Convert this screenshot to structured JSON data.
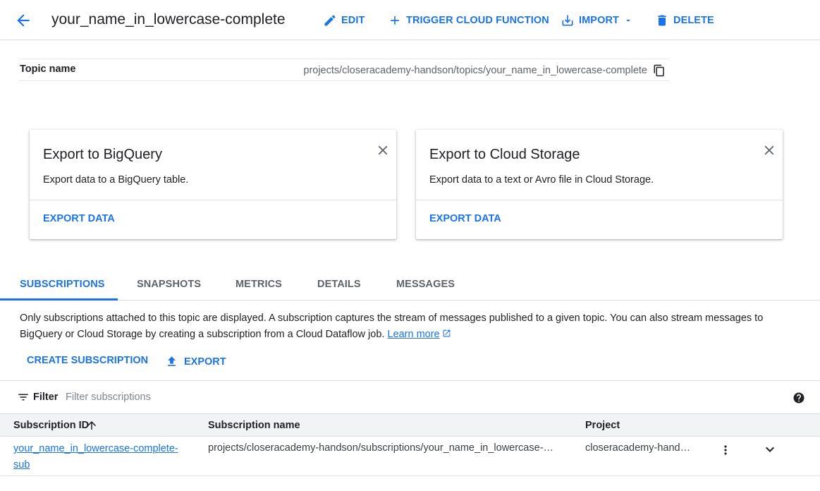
{
  "header": {
    "back_icon": "arrow-back-icon",
    "title": "your_name_in_lowercase-complete",
    "actions": {
      "edit": "EDIT",
      "trigger": "TRIGGER CLOUD FUNCTION",
      "import": "IMPORT",
      "delete": "DELETE"
    }
  },
  "topic": {
    "label": "Topic name",
    "value": "projects/closeracademy-handson/topics/your_name_in_lowercase-complete"
  },
  "cards": [
    {
      "title": "Export to BigQuery",
      "description": "Export data to a BigQuery table.",
      "link": "EXPORT DATA"
    },
    {
      "title": "Export to Cloud Storage",
      "description": "Export data to a text or Avro file in Cloud Storage.",
      "link": "EXPORT DATA"
    }
  ],
  "tabs": [
    {
      "label": "SUBSCRIPTIONS",
      "active": true
    },
    {
      "label": "SNAPSHOTS"
    },
    {
      "label": "METRICS"
    },
    {
      "label": "DETAILS"
    },
    {
      "label": "MESSAGES"
    }
  ],
  "info": {
    "text": "Only subscriptions attached to this topic are displayed. A subscription captures the stream of messages published to a given topic. You can also stream messages to BigQuery or Cloud Storage by creating a subscription from a Cloud Dataflow job.",
    "link": "Learn more"
  },
  "actions": {
    "create": "CREATE SUBSCRIPTION",
    "export": "EXPORT"
  },
  "filter": {
    "label": "Filter",
    "placeholder": "Filter subscriptions"
  },
  "table": {
    "columns": [
      "Subscription ID",
      "Subscription name",
      "Project"
    ],
    "rows": [
      {
        "id": "your_name_in_lowercase-complete-sub",
        "name": "projects/closeracademy-handson/subscriptions/your_name_in_lowercase-…",
        "project": "closeracademy-hand…"
      }
    ]
  },
  "colors": {
    "accent": "#1a73e8",
    "text": "#202124",
    "muted": "#5f6368",
    "divider": "#dadce0",
    "header_bg": "#f1f3f4"
  }
}
